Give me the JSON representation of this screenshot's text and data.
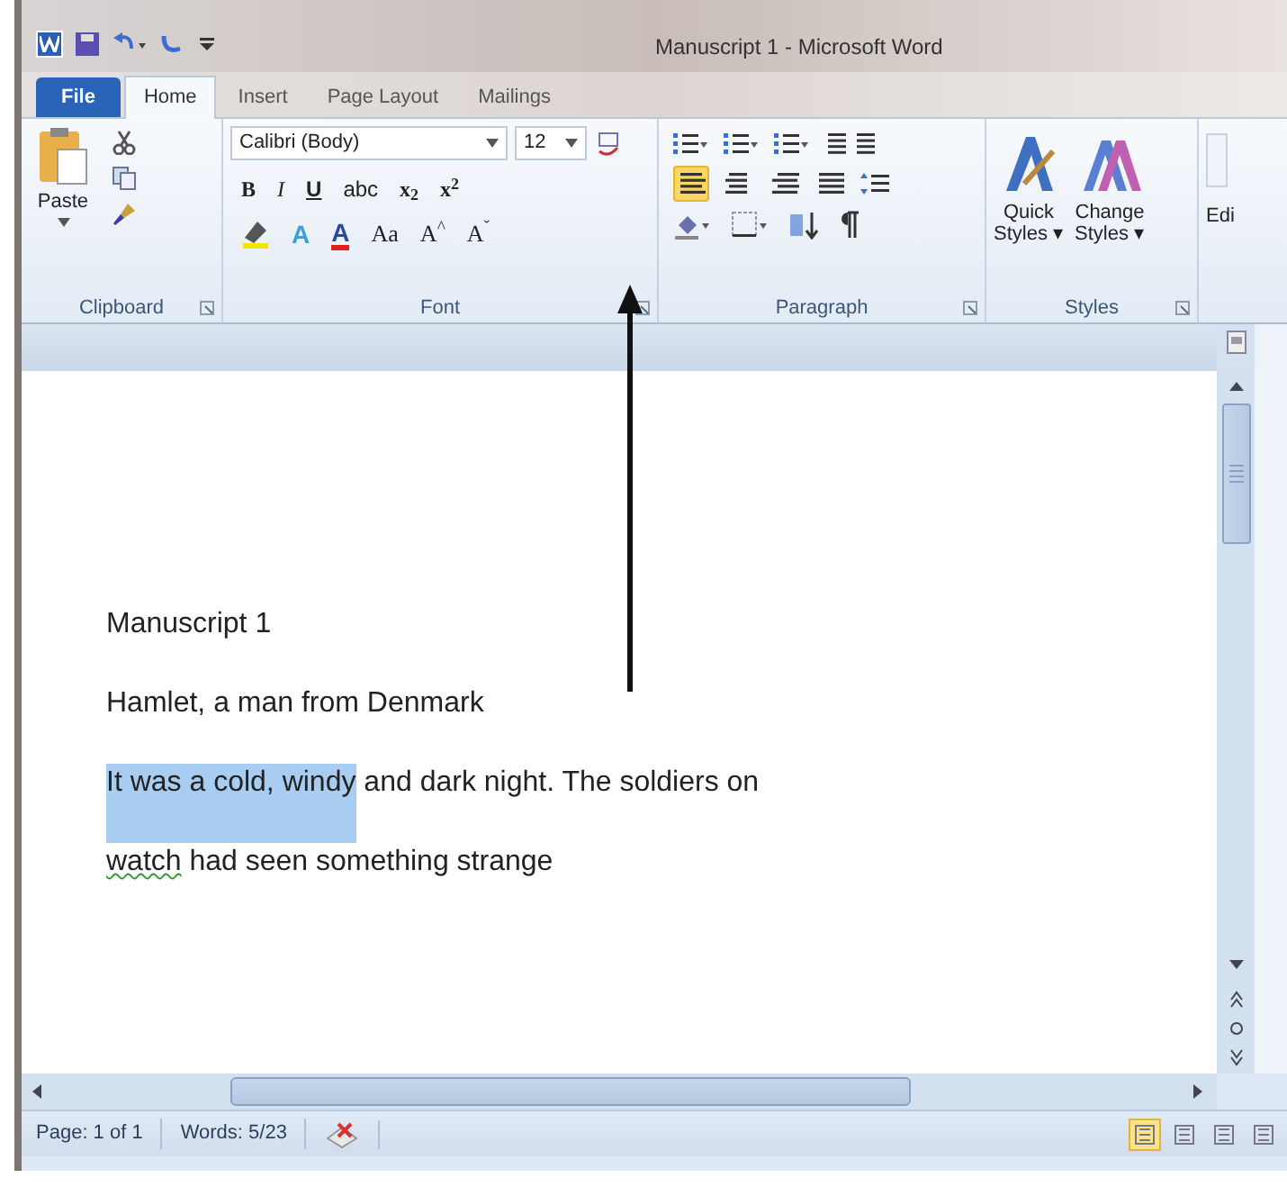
{
  "window": {
    "title": "Manuscript 1 - Microsoft Word"
  },
  "tabs": [
    {
      "label": "File",
      "kind": "file",
      "selected": false
    },
    {
      "label": "Home",
      "kind": "tab",
      "selected": true
    },
    {
      "label": "Insert",
      "kind": "tab",
      "selected": false
    },
    {
      "label": "Page Layout",
      "kind": "tab",
      "selected": false
    },
    {
      "label": "Mailings",
      "kind": "tab",
      "selected": false
    }
  ],
  "clipboard": {
    "paste": "Paste",
    "label": "Clipboard"
  },
  "font": {
    "name": "Calibri (Body)",
    "size": "12",
    "label": "Font",
    "row1": [
      {
        "label": "B",
        "kind": "bold"
      },
      {
        "label": "I",
        "kind": "italic"
      },
      {
        "label": "U",
        "kind": "underline"
      },
      {
        "label": "abc",
        "kind": "strike"
      },
      {
        "label": "x$_{2}$",
        "kind": "plain"
      },
      {
        "label": "x$^{2}$",
        "kind": "plain"
      }
    ],
    "row2": [
      {
        "label": "A",
        "kind": "effects"
      },
      {
        "label": "A",
        "kind": "color"
      },
      {
        "label": "Aa",
        "kind": "plain"
      },
      {
        "label": "A$^{^}$",
        "kind": "plain"
      },
      {
        "label": "A$^{ˇ}$",
        "kind": "plain"
      }
    ]
  },
  "paragraph": {
    "label": "Paragraph",
    "alignments": [
      {
        "selected": true
      },
      {
        "selected": false
      },
      {
        "selected": false
      },
      {
        "selected": false
      }
    ]
  },
  "styles": {
    "label": "Styles",
    "buttons": [
      {
        "line1": "Quick",
        "line2": "Styles ▾",
        "kind": "quick"
      },
      {
        "line1": "Change",
        "line2": "Styles ▾",
        "kind": "change"
      }
    ]
  },
  "editing": {
    "label": "Edi"
  },
  "document": {
    "paragraphs": [
      {
        "segments": [
          {
            "text": "Manuscript 1",
            "selected": false,
            "misspelled": false
          }
        ]
      },
      {
        "segments": [
          {
            "text": "Hamlet, a man from Denmark",
            "selected": false,
            "misspelled": false
          }
        ]
      },
      {
        "segments": [
          {
            "text": "It was a cold, windy",
            "selected": true,
            "misspelled": false
          },
          {
            "text": " and dark night. The soldiers on",
            "selected": false,
            "misspelled": false
          }
        ]
      },
      {
        "segments": [
          {
            "text": "watch",
            "selected": false,
            "misspelled": true
          },
          {
            "text": " had seen something strange",
            "selected": false,
            "misspelled": false
          }
        ]
      }
    ]
  },
  "status_bar": {
    "page": "Page: 1 of 1",
    "words": "Words: 5/23",
    "views": [
      {
        "selected": true
      },
      {
        "selected": false
      },
      {
        "selected": false
      },
      {
        "selected": false
      }
    ]
  }
}
